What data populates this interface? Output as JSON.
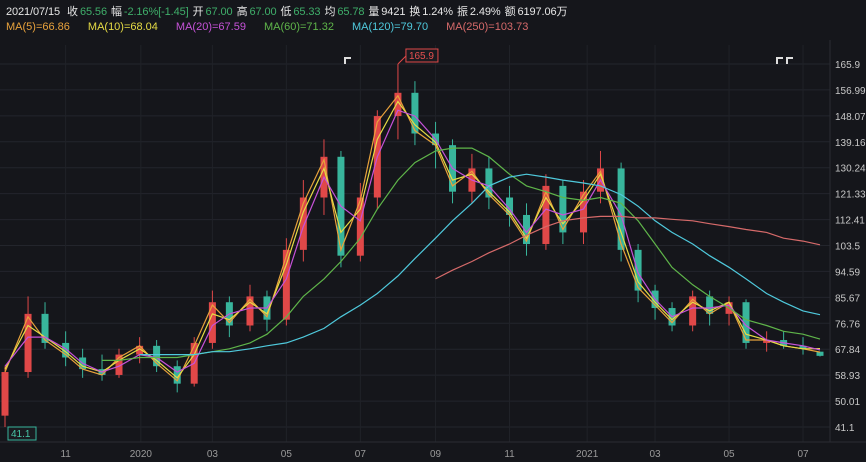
{
  "header": {
    "date": "2021/07/15",
    "fields": [
      {
        "label": "收",
        "value": "65.56",
        "color": "#3fae6a"
      },
      {
        "label": "幅",
        "value": "-2.16%[-1.45]",
        "color": "#3fae6a"
      },
      {
        "label": "开",
        "value": "67.00",
        "color": "#3fae6a"
      },
      {
        "label": "高",
        "value": "67.00",
        "color": "#3fae6a"
      },
      {
        "label": "低",
        "value": "65.33",
        "color": "#3fae6a"
      },
      {
        "label": "均",
        "value": "65.78",
        "color": "#3fae6a"
      },
      {
        "label": "量",
        "value": "9421",
        "color": "#e6e6e6"
      },
      {
        "label": "换",
        "value": "1.24%",
        "color": "#e6e6e6"
      },
      {
        "label": "振",
        "value": "2.49%",
        "color": "#e6e6e6"
      },
      {
        "label": "额",
        "value": "6197.06万",
        "color": "#e6e6e6"
      }
    ]
  },
  "ma_legend": [
    {
      "text": "MA(5)=66.86",
      "color": "#e8a23c"
    },
    {
      "text": "MA(10)=68.04",
      "color": "#e6dc45"
    },
    {
      "text": "MA(20)=67.59",
      "color": "#c652d8"
    },
    {
      "text": "MA(60)=71.32",
      "color": "#5fb54a"
    },
    {
      "text": "MA(120)=79.70",
      "color": "#4fc9dc"
    },
    {
      "text": "MA(250)=103.73",
      "color": "#d66a6a"
    }
  ],
  "chart_data": {
    "type": "candlestick",
    "up_color": "#e04848",
    "down_color": "#38b59c",
    "ylim": [
      41.1,
      165.9
    ],
    "y_ticks": [
      "165.9",
      "156.99",
      "148.07",
      "139.16",
      "130.24",
      "121.33",
      "112.41",
      "103.5",
      "94.59",
      "85.67",
      "76.76",
      "67.84",
      "58.93",
      "50.01",
      "41.1"
    ],
    "x_ticks": [
      {
        "label": "11",
        "date": "2019-11-01"
      },
      {
        "label": "2020",
        "date": "2020-01-02"
      },
      {
        "label": "03",
        "date": "2020-03-01"
      },
      {
        "label": "05",
        "date": "2020-05-01"
      },
      {
        "label": "07",
        "date": "2020-07-01"
      },
      {
        "label": "09",
        "date": "2020-09-01"
      },
      {
        "label": "11",
        "date": "2020-11-01"
      },
      {
        "label": "2021",
        "date": "2021-01-04"
      },
      {
        "label": "03",
        "date": "2021-03-01"
      },
      {
        "label": "05",
        "date": "2021-05-01"
      },
      {
        "label": "07",
        "date": "2021-07-01"
      }
    ],
    "max_label": "165.9",
    "min_label": "41.1",
    "dates": [
      "2019-09-12",
      "2019-10-01",
      "2019-10-15",
      "2019-11-01",
      "2019-11-15",
      "2019-12-01",
      "2019-12-15",
      "2020-01-01",
      "2020-01-15",
      "2020-02-01",
      "2020-02-15",
      "2020-03-01",
      "2020-03-15",
      "2020-04-01",
      "2020-04-15",
      "2020-05-01",
      "2020-05-15",
      "2020-06-01",
      "2020-06-15",
      "2020-07-01",
      "2020-07-15",
      "2020-08-01",
      "2020-08-15",
      "2020-09-01",
      "2020-09-15",
      "2020-10-01",
      "2020-10-15",
      "2020-11-01",
      "2020-11-15",
      "2020-12-01",
      "2020-12-15",
      "2021-01-01",
      "2021-01-15",
      "2021-02-01",
      "2021-02-15",
      "2021-03-01",
      "2021-03-15",
      "2021-04-01",
      "2021-04-15",
      "2021-05-01",
      "2021-05-15",
      "2021-06-01",
      "2021-06-15",
      "2021-07-01",
      "2021-07-15"
    ],
    "ohlc": [
      [
        45,
        62,
        41.1,
        60
      ],
      [
        60,
        86,
        58,
        80
      ],
      [
        80,
        84,
        68,
        70
      ],
      [
        70,
        74,
        62,
        65
      ],
      [
        65,
        68,
        58,
        61
      ],
      [
        61,
        66,
        57,
        59
      ],
      [
        59,
        68,
        58,
        66
      ],
      [
        66,
        72,
        63,
        69
      ],
      [
        69,
        71,
        60,
        62
      ],
      [
        62,
        64,
        53,
        56
      ],
      [
        56,
        72,
        55,
        70
      ],
      [
        70,
        88,
        68,
        84
      ],
      [
        84,
        86,
        72,
        76
      ],
      [
        76,
        90,
        74,
        86
      ],
      [
        86,
        88,
        74,
        78
      ],
      [
        78,
        106,
        76,
        102
      ],
      [
        102,
        126,
        98,
        120
      ],
      [
        120,
        140,
        114,
        134
      ],
      [
        134,
        136,
        96,
        100
      ],
      [
        100,
        125,
        98,
        120
      ],
      [
        120,
        150,
        116,
        148
      ],
      [
        148,
        165.9,
        140,
        156
      ],
      [
        156,
        160,
        138,
        142
      ],
      [
        142,
        146,
        130,
        138
      ],
      [
        138,
        140,
        118,
        122
      ],
      [
        122,
        135,
        118,
        130
      ],
      [
        130,
        134,
        116,
        120
      ],
      [
        120,
        124,
        110,
        114
      ],
      [
        114,
        118,
        100,
        104
      ],
      [
        104,
        128,
        102,
        124
      ],
      [
        124,
        126,
        104,
        108
      ],
      [
        108,
        126,
        104,
        122
      ],
      [
        122,
        136,
        118,
        130
      ],
      [
        130,
        132,
        98,
        102
      ],
      [
        102,
        104,
        84,
        88
      ],
      [
        88,
        90,
        78,
        82
      ],
      [
        82,
        84,
        74,
        76
      ],
      [
        76,
        88,
        74,
        86
      ],
      [
        86,
        88,
        76,
        80
      ],
      [
        80,
        86,
        76,
        84
      ],
      [
        84,
        85,
        68,
        70
      ],
      [
        70,
        74,
        67,
        71
      ],
      [
        71,
        74,
        68,
        69
      ],
      [
        69,
        72,
        66,
        68
      ],
      [
        67,
        67,
        65.33,
        65.56
      ]
    ],
    "series": [
      {
        "name": "MA(5)",
        "color": "#e8a23c",
        "values": [
          60,
          79,
          71,
          66,
          61,
          59,
          65,
          69,
          63,
          57,
          69,
          83,
          77,
          85,
          79,
          100,
          118,
          133,
          102,
          119,
          146,
          155,
          143,
          138,
          124,
          129,
          121,
          114,
          105,
          122,
          109,
          121,
          129,
          104,
          89,
          83,
          77,
          85,
          80,
          84,
          71,
          71,
          69,
          68,
          66.86
        ]
      },
      {
        "name": "MA(10)",
        "color": "#e6dc45",
        "values": [
          61,
          76,
          72,
          67,
          62,
          60,
          64,
          68,
          64,
          58,
          66,
          80,
          78,
          84,
          80,
          97,
          115,
          130,
          108,
          116,
          140,
          153,
          145,
          139,
          126,
          128,
          122,
          115,
          106,
          120,
          111,
          119,
          128,
          108,
          91,
          84,
          78,
          84,
          81,
          84,
          73,
          71,
          69,
          68,
          68.04
        ]
      },
      {
        "name": "MA(20)",
        "color": "#c652d8",
        "values": [
          62,
          72,
          72,
          68,
          63,
          60,
          62,
          66,
          65,
          60,
          63,
          76,
          80,
          82,
          82,
          92,
          110,
          127,
          117,
          112,
          134,
          150,
          148,
          140,
          130,
          126,
          124,
          116,
          108,
          116,
          114,
          116,
          126,
          114,
          94,
          85,
          79,
          82,
          82,
          83,
          76,
          71,
          70,
          69,
          67.59
        ]
      },
      {
        "name": "MA(60)",
        "color": "#5fb54a",
        "values": [
          null,
          null,
          null,
          null,
          null,
          64,
          64,
          65,
          65,
          65,
          66,
          67,
          68,
          70,
          73,
          79,
          86,
          92,
          98,
          106,
          116,
          126,
          132,
          136,
          137,
          137,
          134,
          128,
          124,
          122,
          120,
          119,
          120,
          118,
          112,
          104,
          96,
          90,
          86,
          82,
          78,
          76,
          74,
          73,
          71.32
        ]
      },
      {
        "name": "MA(120)",
        "color": "#4fc9dc",
        "values": [
          null,
          null,
          null,
          null,
          null,
          null,
          null,
          66,
          66,
          66,
          66,
          67,
          67,
          68,
          69,
          70,
          72,
          75,
          79,
          83,
          87,
          93,
          99,
          106,
          112,
          118,
          124,
          127,
          128,
          127,
          126,
          125,
          124,
          121,
          117,
          112,
          108,
          104,
          100,
          96,
          92,
          87,
          84,
          81,
          79.7
        ]
      },
      {
        "name": "MA(250)",
        "color": "#d66a6a",
        "values": [
          null,
          null,
          null,
          null,
          null,
          null,
          null,
          null,
          null,
          null,
          null,
          null,
          null,
          null,
          null,
          null,
          null,
          null,
          null,
          null,
          null,
          null,
          null,
          92,
          95,
          98,
          101,
          104,
          107,
          110,
          112,
          113,
          113.5,
          113.5,
          113,
          113,
          112.5,
          112,
          111,
          110,
          109,
          108,
          106,
          105,
          103.73
        ]
      }
    ],
    "grid": true
  }
}
